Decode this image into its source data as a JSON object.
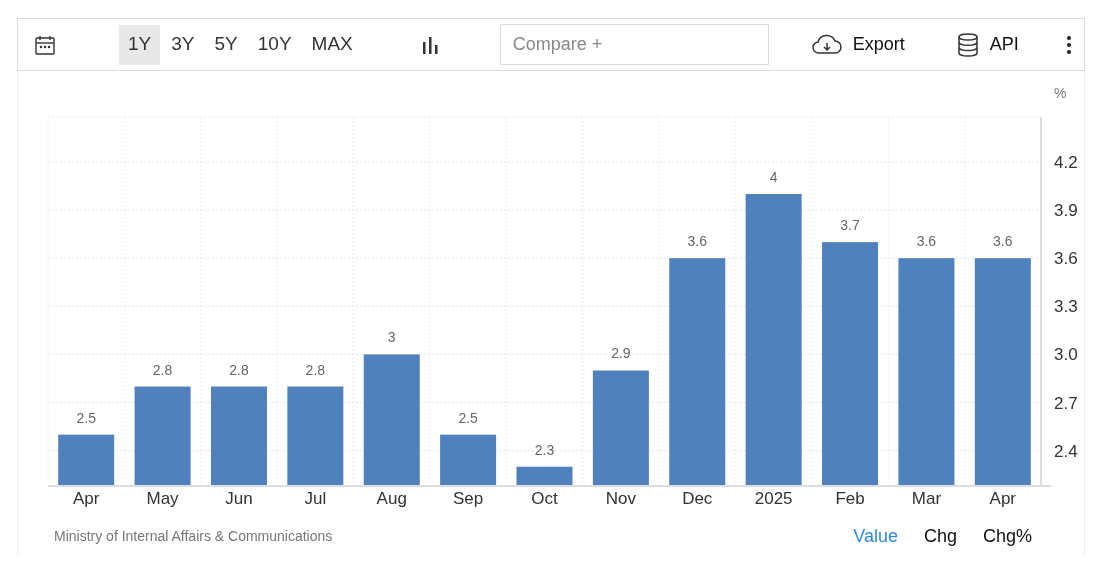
{
  "toolbar": {
    "ranges": [
      {
        "label": "1Y",
        "selected": true
      },
      {
        "label": "3Y",
        "selected": false
      },
      {
        "label": "5Y",
        "selected": false
      },
      {
        "label": "10Y",
        "selected": false
      },
      {
        "label": "MAX",
        "selected": false
      }
    ],
    "compare": {
      "placeholder": "Compare +"
    },
    "export": "Export",
    "api": "API"
  },
  "chart": {
    "unit": "%",
    "chart_data": {
      "type": "bar",
      "categories": [
        "Apr",
        "May",
        "Jun",
        "Jul",
        "Aug",
        "Sep",
        "Oct",
        "Nov",
        "Dec",
        "2025",
        "Feb",
        "Mar",
        "Apr"
      ],
      "grid": true,
      "series": [
        {
          "color": "#4f81bd",
          "values": [
            2.5,
            2.8,
            2.8,
            2.8,
            3,
            2.5,
            2.3,
            2.9,
            3.6,
            4,
            3.7,
            3.6,
            3.6
          ]
        }
      ],
      "value_labels": [
        "2.5",
        "2.8",
        "2.8",
        "2.8",
        "3",
        "2.5",
        "2.3",
        "2.9",
        "3.6",
        "4",
        "3.7",
        "3.6",
        "3.6"
      ],
      "ylim": [
        2.18,
        4.48
      ],
      "yticks": [
        {
          "value": 2.4,
          "label": "2.4"
        },
        {
          "value": 2.7,
          "label": "2.7"
        },
        {
          "value": 3.0,
          "label": "3.0"
        },
        {
          "value": 3.3,
          "label": "3.3"
        },
        {
          "value": 3.6,
          "label": "3.6"
        },
        {
          "value": 3.9,
          "label": "3.9"
        },
        {
          "value": 4.2,
          "label": "4.2"
        }
      ],
      "data_labels": true
    }
  },
  "footer": {
    "source": "Ministry of Internal Affairs & Communications",
    "views": [
      {
        "label": "Value",
        "selected": true
      },
      {
        "label": "Chg",
        "selected": false
      },
      {
        "label": "Chg%",
        "selected": false
      }
    ]
  }
}
